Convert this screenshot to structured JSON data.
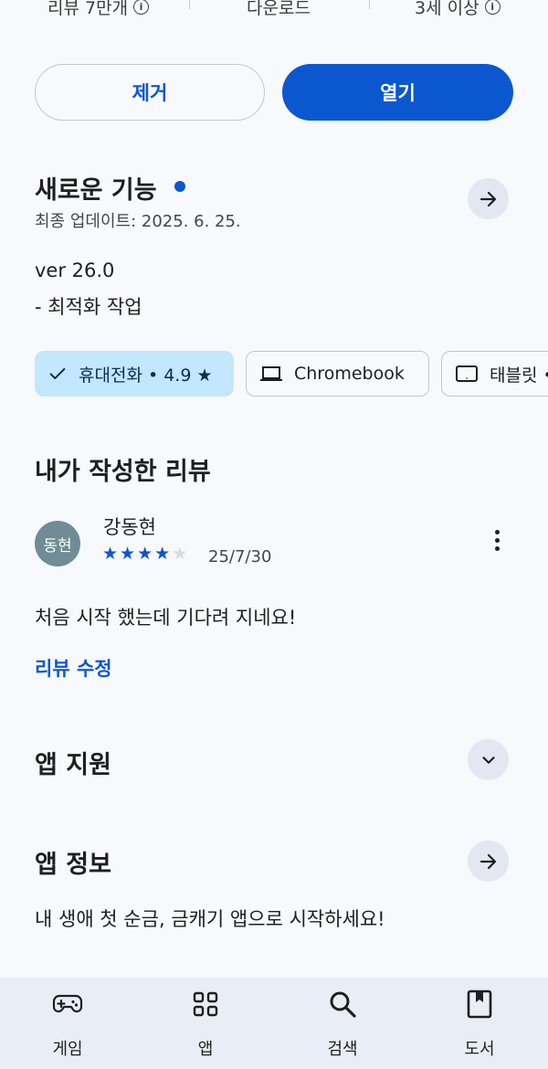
{
  "stats": {
    "reviews": "리뷰 7만개",
    "downloads": "다운로드",
    "age_rating": "3세 이상"
  },
  "actions": {
    "remove_label": "제거",
    "open_label": "열기"
  },
  "whats_new": {
    "title": "새로운 기능",
    "last_updated": "최종 업데이트: 2025. 6. 25.",
    "version": "ver 26.0",
    "notes": "- 최적화 작업"
  },
  "device_chips": {
    "phone": "휴대전화 • 4.9 ★",
    "chromebook": "Chromebook",
    "tablet": "태블릿 •"
  },
  "my_review": {
    "section_title": "내가 작성한 리뷰",
    "avatar_text": "동현",
    "author": "강동현",
    "rating": 4,
    "rating_max": 5,
    "date": "25/7/30",
    "text": "처음 시작 했는데 기다려 지네요!",
    "edit_label": "리뷰 수정"
  },
  "app_support": {
    "title": "앱 지원"
  },
  "app_info": {
    "title": "앱 정보",
    "description": "내 생애 첫 순금, 금캐기 앱으로 시작하세요!"
  },
  "bottom_nav": {
    "games": "게임",
    "apps": "앱",
    "search": "검색",
    "books": "도서"
  },
  "colors": {
    "accent": "#0b57d0",
    "chip_selected": "#c2e7ff",
    "background": "#f8f9fd",
    "nav_background": "#e9eef6"
  }
}
